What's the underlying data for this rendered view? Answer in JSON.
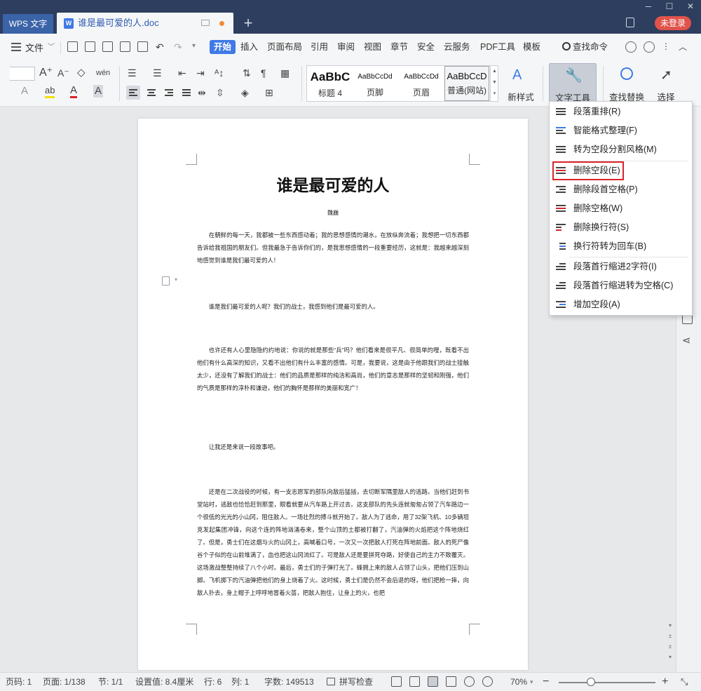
{
  "titlebar": {
    "app_tab": "WPS 文字",
    "doc_tab_title": "谁是最可爱的人.doc",
    "new_tab": "+",
    "window": {
      "minimize": "─",
      "maximize": "☐",
      "close": "✕"
    },
    "login_button": "未登录"
  },
  "menubar": {
    "file": "文件",
    "tabs": [
      "开始",
      "插入",
      "页面布局",
      "引用",
      "审阅",
      "视图",
      "章节",
      "安全",
      "云服务",
      "PDF工具",
      "模板"
    ],
    "active_tab": "开始",
    "search_command": "查找命令"
  },
  "ribbon": {
    "styles": [
      {
        "sample": "AaBbC",
        "label": "标题 4"
      },
      {
        "sample": "AaBbCcDd",
        "label": "页脚"
      },
      {
        "sample": "AaBbCcDd",
        "label": "页眉"
      },
      {
        "sample": "AaBbCcD",
        "label": "普通(网站)"
      }
    ],
    "new_style": "新样式",
    "text_tools": "文字工具",
    "find_replace": "查找替换",
    "select": "选择"
  },
  "dropdown": {
    "items": [
      {
        "label": "段落重排(R)",
        "icon": "paragraph-rearrange-icon"
      },
      {
        "label": "智能格式整理(F)",
        "icon": "smart-format-icon"
      },
      {
        "label": "转为空段分割风格(M)",
        "icon": "empty-paragraph-split-icon"
      },
      {
        "label": "删除空段(E)",
        "icon": "delete-empty-paragraph-icon"
      },
      {
        "label": "删除段首空格(P)",
        "icon": "delete-leading-space-icon"
      },
      {
        "label": "删除空格(W)",
        "icon": "delete-space-icon"
      },
      {
        "label": "删除换行符(S)",
        "icon": "delete-line-break-icon"
      },
      {
        "label": "换行符转为回车(B)",
        "icon": "line-break-to-enter-icon"
      },
      {
        "label": "段落首行缩进2字符(I)",
        "icon": "first-line-indent-icon"
      },
      {
        "label": "段落首行缩进转为空格(C)",
        "icon": "indent-to-space-icon"
      },
      {
        "label": "增加空段(A)",
        "icon": "add-empty-paragraph-icon"
      }
    ],
    "highlighted": "删除空段(E)",
    "highlight_color": "#d9232b"
  },
  "document": {
    "title": "谁是最可爱的人",
    "author": "魏巍",
    "paragraphs": [
      "在朝鲜的每一天，我都被一些东西感动着；我的思想感情的潮水，在放纵奔流着；我想把一切东西都告诉给我祖国的朋友们。但我最急于告诉你们的，是我思想感情的一段重要经历，这就是：我越来越深刻地感觉到谁是我们最可爱的人！",
      "谁是我们最可爱的人呢？我们的战士，我感到他们是最可爱的人。",
      "也许还有人心里隐隐约约地说：你说的就是那些“兵”吗？他们看来是很平凡、很简单的哩，既看不出他们有什么高深的知识，又看不出他们有什么丰富的感情。可是，我要说，这是由于他跟我们的战士接触太少，还没有了解我们的战士：他们的品质是那样的纯洁和高尚，他们的意志是那样的坚韧和刚强，他们的气质是那样的淳朴和谦逊，他们的胸怀是那样的美丽和宽广！",
      "让我还是来说一段故事吧。",
      "还是在二次战役的时候，有一支志愿军的部队向敌后猛插，去切断军隅里敌人的逃路。当他们赶到书堂站时，逃敌也恰恰赶到那里，眼看就要从汽车路上开过去。这支部队的先头连就匆匆占领了汽车路边一个很低的光光的小山冈，阻住敌人。一场壮烈的搏斗就开始了。敌人为了逃命，用了32架飞机、10多辆坦克发起集团冲锋，向这个连的阵地汹涌卷来，整个山顶的土都被打翻了，汽油弹的火焰把这个阵地烧红了。但是，勇士们在这烟与火的山冈上，高喊着口号，一次又一次把敌人打死在阵地前面。敌人的死尸像谷个子似的在山前堆满了，血也把这山冈流红了。可是敌人还是要拼死夺路，好使自己的主力不致覆灭。这场激战整整持续了八个小时。最后，勇士们的子弹打光了。蜂拥上来的敌人占领了山头，把他们压到山脚。飞机掷下的汽油弹把他们的身上烧着了火。这时候，勇士们是仍然不会后退的呀，他们把枪一摔，向敌人扑去，身上帽子上呼呼地冒着火苗，把敌人抱住，让身上的火，也把"
    ]
  },
  "statusbar": {
    "page_code": "页码: 1",
    "page": "页面: 1/138",
    "section": "节: 1/1",
    "setting": "设置值: 8.4厘米",
    "row": "行: 6",
    "col": "列: 1",
    "word_count": "字数: 149513",
    "spell_check": "拼写检查",
    "zoom": "70%"
  },
  "colors": {
    "title_bar": "#2d3e5e",
    "accent": "#3f7ae6",
    "login": "#e0534a"
  }
}
